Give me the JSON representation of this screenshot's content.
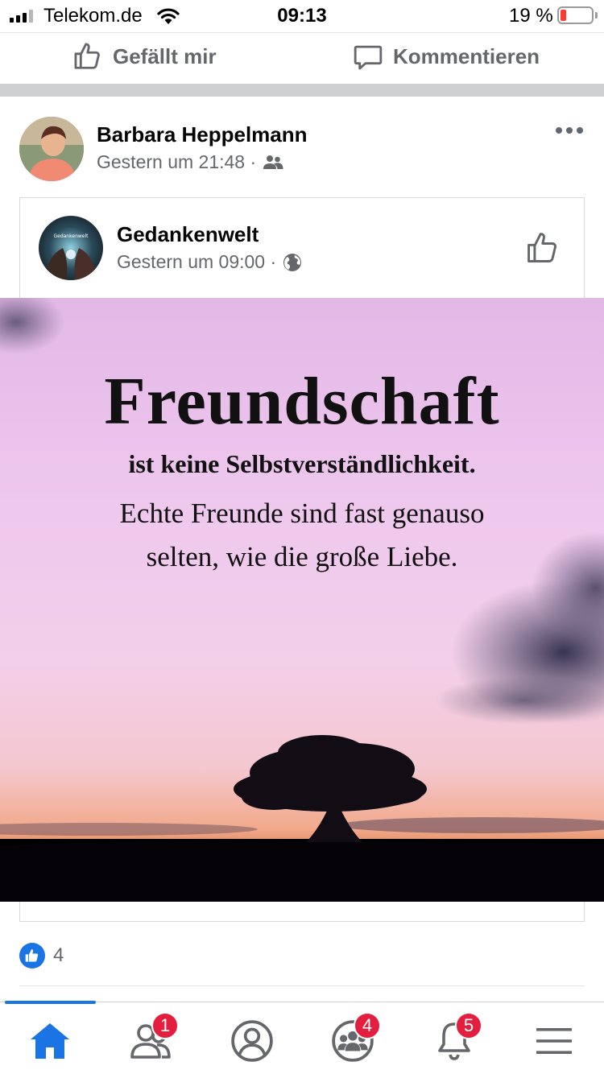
{
  "status_bar": {
    "carrier": "Telekom.de",
    "time": "09:13",
    "battery_percent": "19 %"
  },
  "previous_post": {
    "like_label": "Gefällt mir",
    "comment_label": "Kommentieren"
  },
  "post": {
    "author": "Barbara Heppelmann",
    "timestamp": "Gestern um 21:48 ·",
    "audience_icon": "friends-icon",
    "shared": {
      "page_name": "Gedankenwelt",
      "avatar_text": "Gedankenwelt",
      "timestamp": "Gestern um 09:00 ·",
      "audience_icon": "globe-icon",
      "image": {
        "title": "Freundschaft",
        "subtitle": "ist keine Selbstverständlichkeit.",
        "line1": "Echte Freunde sind fast genauso",
        "line2": "selten, wie die große Liebe."
      }
    },
    "reaction_count": "4"
  },
  "bottom_nav": {
    "items": [
      {
        "name": "home",
        "badge": ""
      },
      {
        "name": "friends",
        "badge": "1"
      },
      {
        "name": "profile",
        "badge": ""
      },
      {
        "name": "groups",
        "badge": "4"
      },
      {
        "name": "notifications",
        "badge": "5"
      },
      {
        "name": "menu",
        "badge": ""
      }
    ]
  },
  "colors": {
    "accent": "#1b74e4",
    "badge": "#e41e3f",
    "muted_text": "#65676b"
  }
}
